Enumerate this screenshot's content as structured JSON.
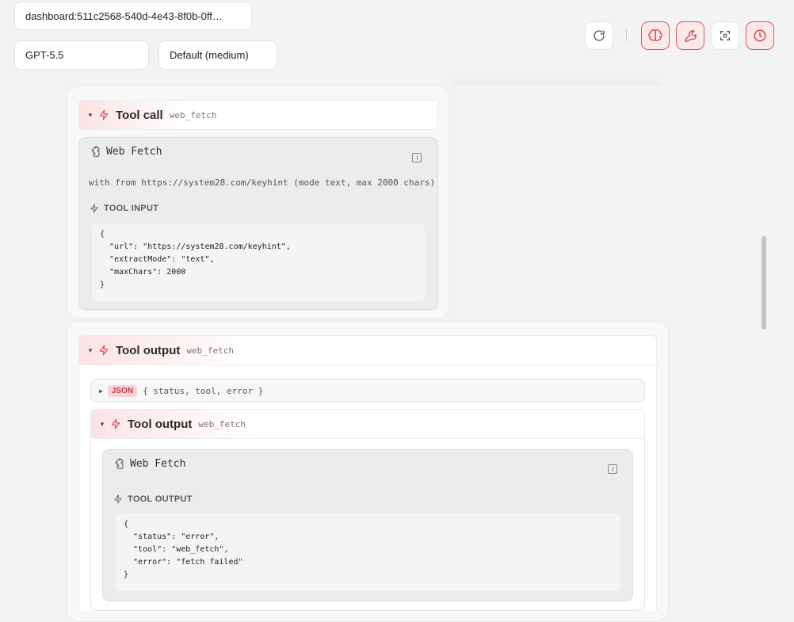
{
  "session": {
    "value": "dashboard:511c2568-540d-4e43-8f0b-0ff…"
  },
  "model": {
    "value": "GPT-5.5"
  },
  "effort": {
    "value": "Default (medium)"
  },
  "toolbar": {
    "buttons": [
      {
        "name": "refresh-icon",
        "active": false
      },
      {
        "name": "brain-icon",
        "active": true
      },
      {
        "name": "wrench-icon",
        "active": true
      },
      {
        "name": "focus-icon",
        "active": false
      },
      {
        "name": "clock-icon",
        "active": true
      }
    ],
    "accent": "#d85a62"
  },
  "tool_call": {
    "title": "Tool call",
    "tool": "web_fetch",
    "card_title": "Web Fetch",
    "description": "with from https://system28.com/keyhint (mode text, max 2000 chars)",
    "section": "TOOL INPUT",
    "code": "{\n  \"url\": \"https://system28.com/keyhint\",\n  \"extractMode\": \"text\",\n  \"maxChars\": 2000\n}"
  },
  "tool_output": {
    "title": "Tool output",
    "tool": "web_fetch",
    "json_badge": "JSON",
    "json_summary": "{ status, tool, error }",
    "inner": {
      "title": "Tool output",
      "tool": "web_fetch",
      "card_title": "Web Fetch",
      "section": "TOOL OUTPUT",
      "code": "{\n  \"status\": \"error\",\n  \"tool\": \"web_fetch\",\n  \"error\": \"fetch failed\"\n}"
    }
  }
}
